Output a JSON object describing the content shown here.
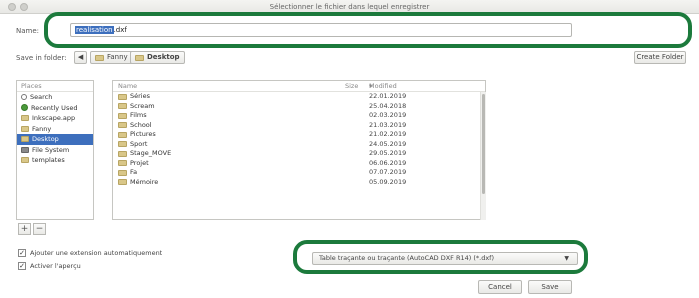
{
  "window": {
    "title": "Sélectionner le fichier dans lequel enregistrer"
  },
  "name_field": {
    "label": "Name:",
    "selected_text": "realisation",
    "suffix": ".dxf"
  },
  "save_in": {
    "label": "Save in folder:",
    "crumbs": [
      "Fanny",
      "Desktop"
    ],
    "create_folder": "Create Folder"
  },
  "places": {
    "header": "Places",
    "items": [
      {
        "label": "Search",
        "icon": "search-icon"
      },
      {
        "label": "Recently Used",
        "icon": "recent-icon"
      },
      {
        "label": "Inkscape.app",
        "icon": "folder-icon"
      },
      {
        "label": "Fanny",
        "icon": "folder-icon"
      },
      {
        "label": "Desktop",
        "icon": "folder-icon",
        "selected": true
      },
      {
        "label": "File System",
        "icon": "disk-icon"
      },
      {
        "label": "templates",
        "icon": "folder-icon"
      }
    ],
    "add_label": "+",
    "remove_label": "−"
  },
  "files": {
    "columns": {
      "name": "Name",
      "size": "Size",
      "modified": "Modified"
    },
    "rows": [
      {
        "name": "Séries",
        "modified": "22.01.2019"
      },
      {
        "name": "Scream",
        "modified": "25.04.2018"
      },
      {
        "name": "Films",
        "modified": "02.03.2019"
      },
      {
        "name": "School",
        "modified": "21.03.2019"
      },
      {
        "name": "Pictures",
        "modified": "21.02.2019"
      },
      {
        "name": "Sport",
        "modified": "24.05.2019"
      },
      {
        "name": "Stage_MOVE",
        "modified": "29.05.2019"
      },
      {
        "name": "Projet",
        "modified": "06.06.2019"
      },
      {
        "name": "Fa",
        "modified": "07.07.2019"
      },
      {
        "name": "Mémoire",
        "modified": "05.09.2019"
      }
    ]
  },
  "options": {
    "auto_extension": "Ajouter une extension automatiquement",
    "preview": "Activer l'aperçu"
  },
  "filetype": {
    "value": "Table traçante ou traçante (AutoCAD DXF R14) (*.dxf)"
  },
  "buttons": {
    "cancel": "Cancel",
    "save": "Save"
  },
  "colors": {
    "highlight_ring": "#1c7a3c",
    "selection": "#3d6fbd"
  }
}
